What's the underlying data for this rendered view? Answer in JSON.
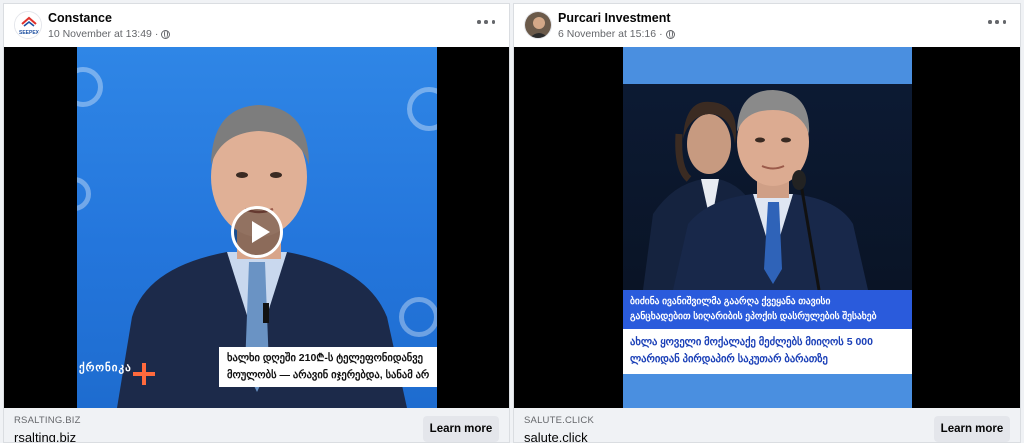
{
  "posts": [
    {
      "author": "Constance",
      "avatar_text": "SEEPEX",
      "timestamp": "10 November at 13:49",
      "video_caption": [
        "ხალხი დღეში 210₾-ს ტელეფონიდანვე",
        "მოულობს — არავინ იჯერებდა, სანამ არ სცადა"
      ],
      "station_logo": "ქრონიკა",
      "domain": "RSALTING.BIZ",
      "link_title": "rsalting.biz",
      "cta": "Learn more"
    },
    {
      "author": "Purcari Investment",
      "timestamp": "6 November at 15:16",
      "caption_top": [
        "ბიძინა ივანიშვილმა გაარღა ქვეყანა თავისი",
        "განცხადებით სიღარიბის ეპოქის დასრულების შესახებ"
      ],
      "caption_bottom": [
        "ახლა ყოველი მოქალაქე მეძლებს მიიღოს 5 000",
        "ლარიდან პირდაპირ საკუთარ ბარათზე"
      ],
      "domain": "SALUTE.CLICK",
      "link_title": "salute.click",
      "cta": "Learn more"
    }
  ],
  "icons": {
    "more": "more-horizontal-icon",
    "audience": "globe-icon",
    "play": "play-icon"
  }
}
